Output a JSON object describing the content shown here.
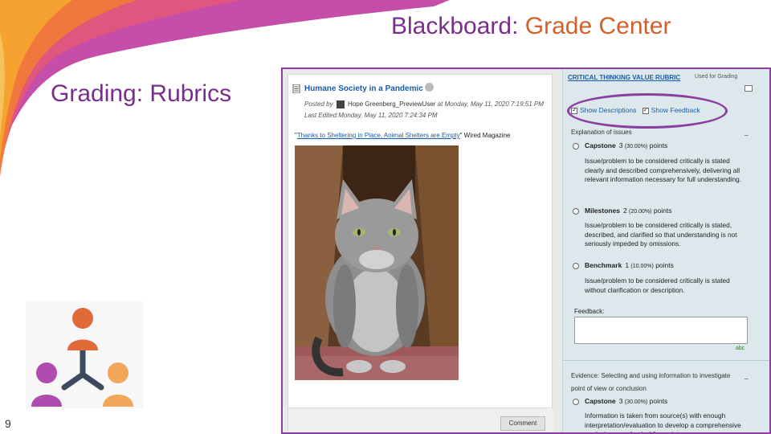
{
  "slide": {
    "title_prefix": "Blackboard: ",
    "title_accent": "Grade Center",
    "subtitle": "Grading: Rubrics",
    "slide_number": "9"
  },
  "post": {
    "title": "Humane Society in a Pandemic",
    "posted_by_label": "Posted by",
    "author": "Hope Greenberg_PreviewUser",
    "posted_date": "at Monday, May 11, 2020 7:19:51 PM",
    "last_edited": "Last Edited:Monday, May 11, 2020 7:24:34 PM",
    "quote_open": "\"",
    "quote_link": "Thanks to Sheltering in Place, Animal Shelters are Empty",
    "quote_close": "\" Wired Magazine",
    "comment_button": "Comment"
  },
  "rubric": {
    "title": "CRITICAL THINKING VALUE RUBRIC",
    "used_for": "Used for Grading",
    "show_descriptions": "Show Descriptions",
    "show_feedback": "Show Feedback",
    "criterion_1": "Explanation of issues",
    "levels_1": [
      {
        "name": "Capstone",
        "points": "3",
        "pct": "(30.00%)",
        "unit": "points",
        "desc": "Issue/problem to be considered critically is stated clearly and described comprehensively, delivering all relevant information necessary for full understanding."
      },
      {
        "name": "Milestones",
        "points": "2",
        "pct": "(20.00%)",
        "unit": "points",
        "desc": "Issue/problem to be considered critically is stated, described, and clarified so that understanding is not seriously impeded by omissions."
      },
      {
        "name": "Benchmark",
        "points": "1",
        "pct": "(10.00%)",
        "unit": "points",
        "desc": "Issue/problem to be considered critically is stated without clarification or description."
      }
    ],
    "feedback_label": "Feedback:",
    "spell_label": "abc",
    "criterion_2": "Evidence: Selecting and using information to investigate",
    "criterion_2_line2": "point of view or conclusion",
    "level_2": {
      "name": "Capstone",
      "points": "3",
      "pct": "(30.00%)",
      "unit": "points",
      "desc": "Information is taken from source(s) with enough interpretation/evaluation to develop a comprehensive analysis or synthesis. Viewpoints"
    },
    "dash": "_"
  },
  "colors": {
    "title_purple": "#7a2e8c",
    "title_orange": "#d2602a",
    "link_blue": "#1a5ba8",
    "panel_bg": "#dde8ec"
  }
}
